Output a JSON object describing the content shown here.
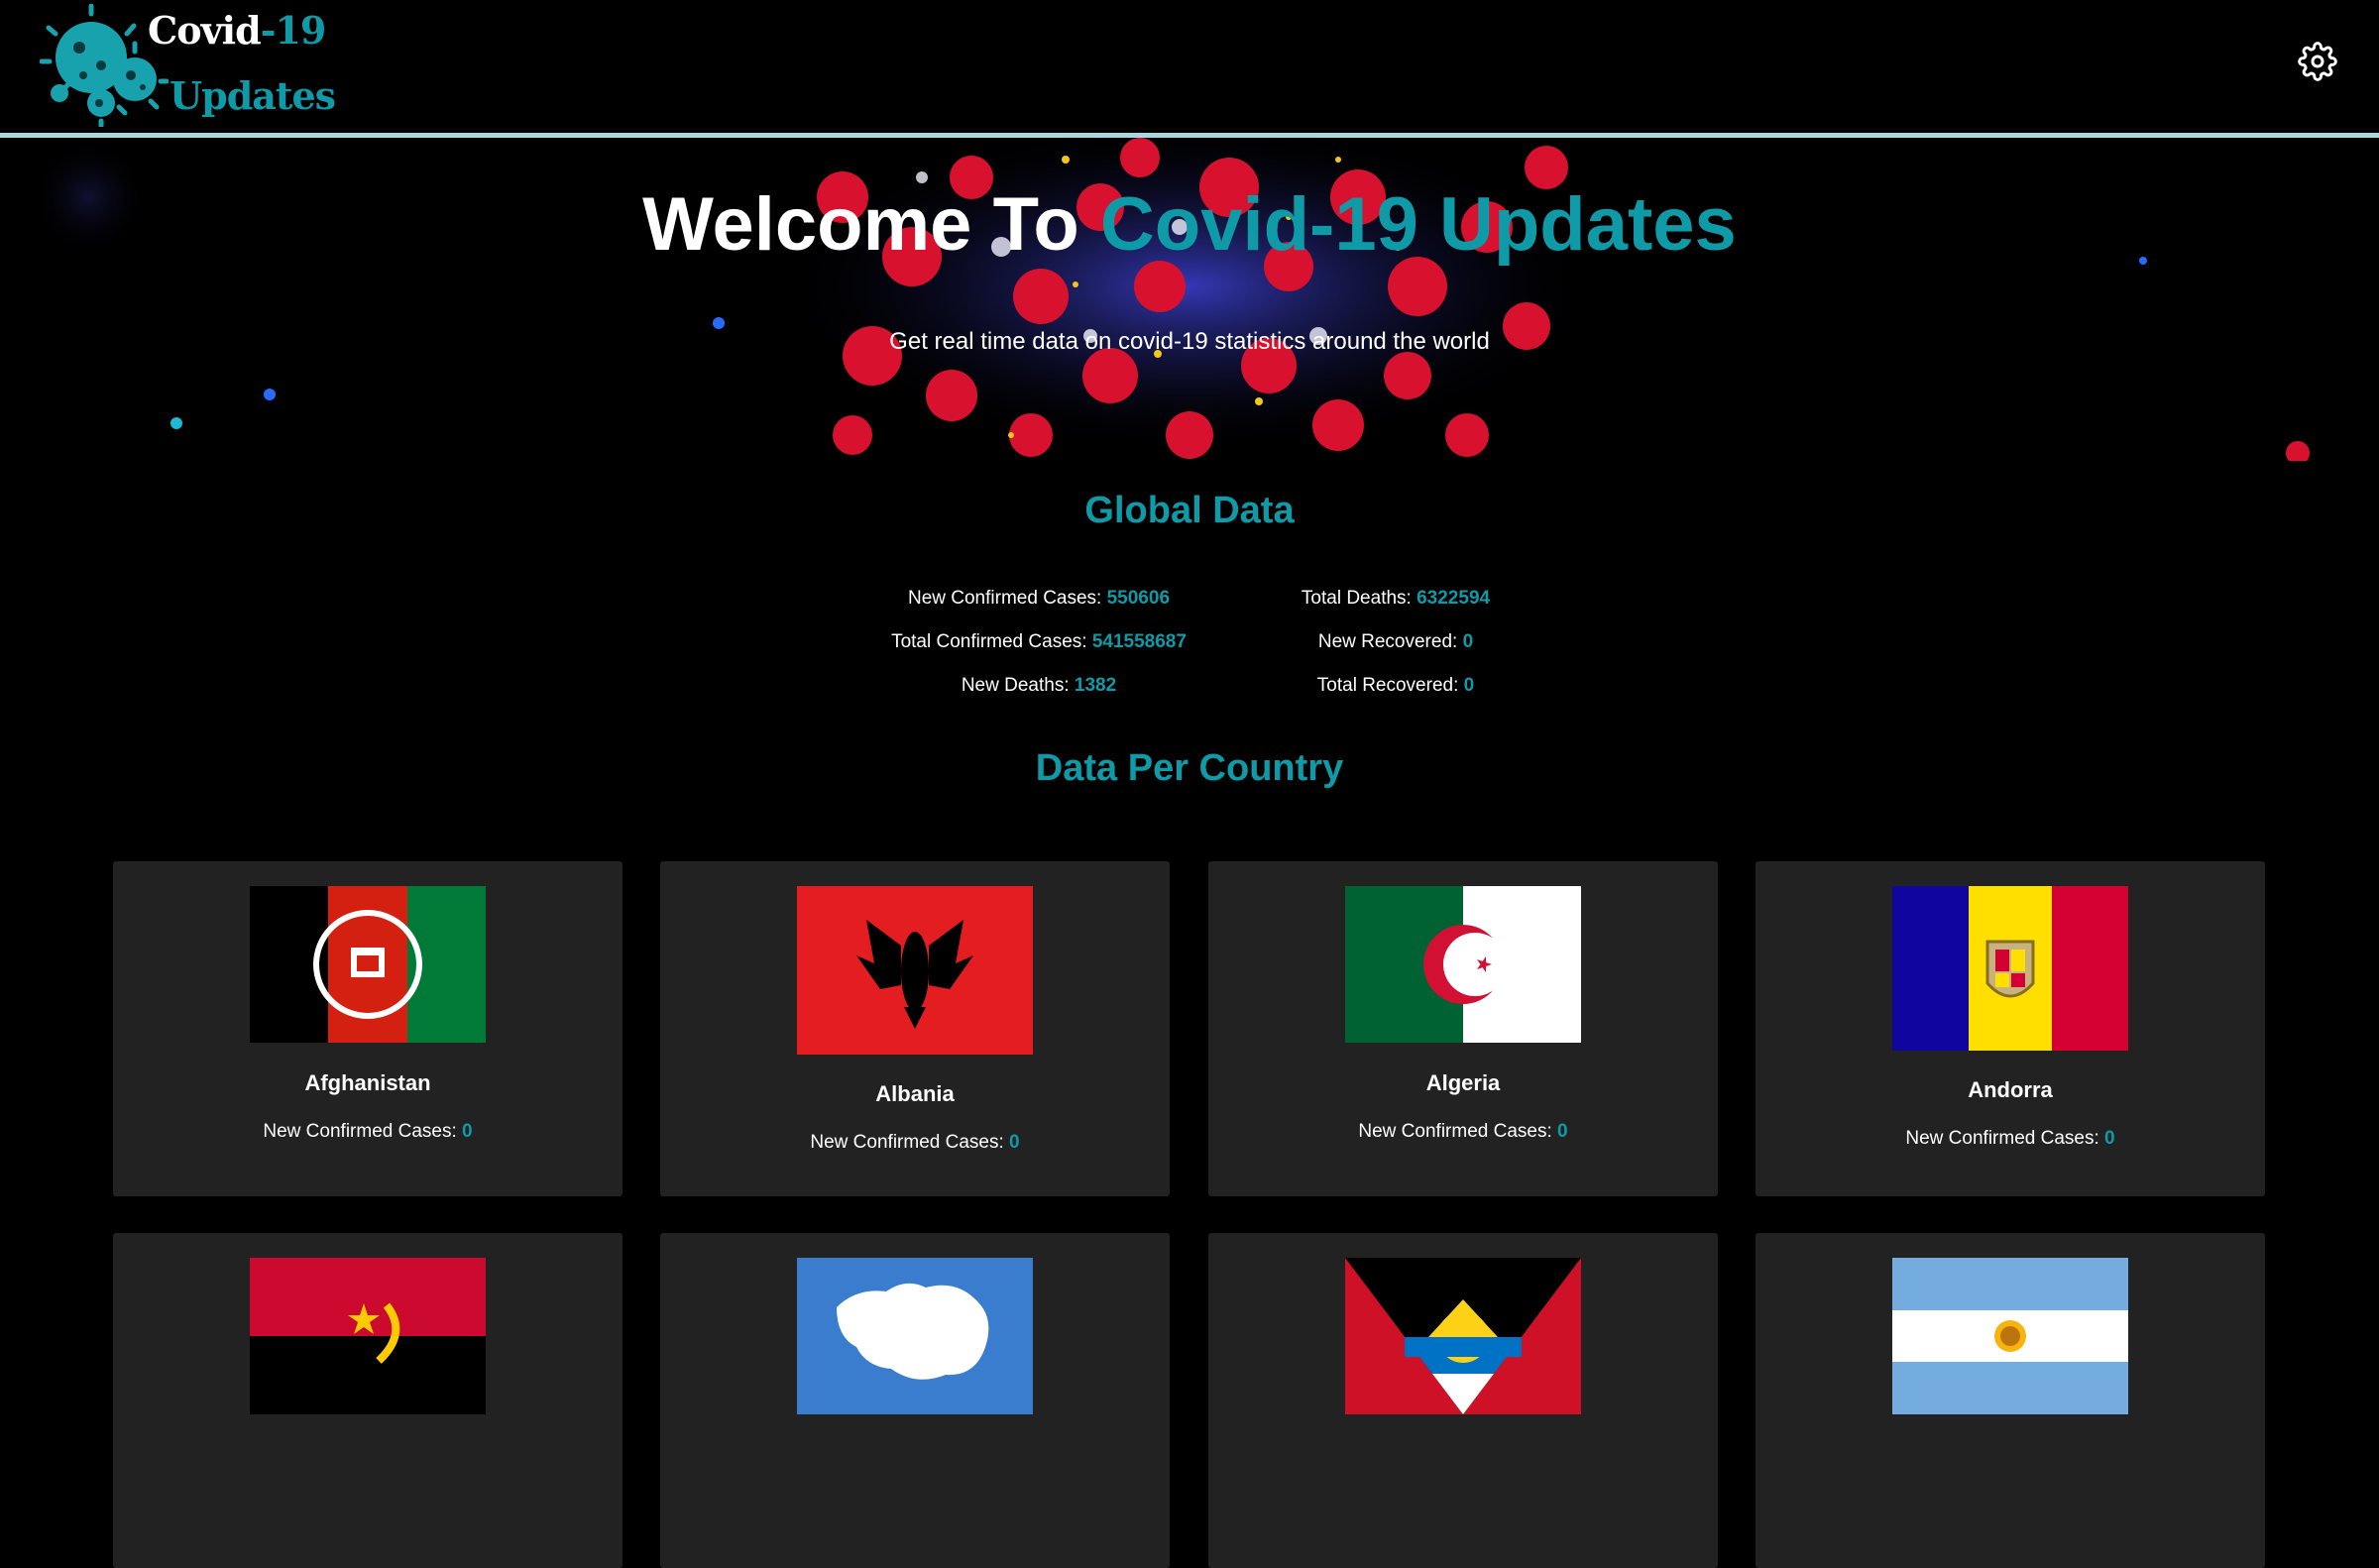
{
  "app": {
    "logo_line1_a": "Covid",
    "logo_line1_b": "-19",
    "logo_line2": "Updates",
    "accent_color": "#0e9aa7"
  },
  "hero": {
    "title_a": "Welcome To ",
    "title_b": "Covid-19 Updates",
    "subtitle": "Get real time data on covid-19 statistics around the world"
  },
  "global": {
    "title": "Global Data",
    "stats": [
      {
        "label": "New Confirmed Cases:",
        "value": "550606"
      },
      {
        "label": "Total Deaths:",
        "value": "6322594"
      },
      {
        "label": "Total Confirmed Cases:",
        "value": "541558687"
      },
      {
        "label": "New Recovered:",
        "value": "0"
      },
      {
        "label": "New Deaths:",
        "value": "1382"
      },
      {
        "label": "Total Recovered:",
        "value": "0"
      }
    ]
  },
  "countries": {
    "title": "Data Per Country",
    "cases_label": "New Confirmed Cases:",
    "items": [
      {
        "name": "Afghanistan",
        "value": "0",
        "flag": "afghanistan-flag"
      },
      {
        "name": "Albania",
        "value": "0",
        "flag": "albania-flag"
      },
      {
        "name": "Algeria",
        "value": "0",
        "flag": "algeria-flag"
      },
      {
        "name": "Andorra",
        "value": "0",
        "flag": "andorra-flag"
      },
      {
        "name": "",
        "value": "",
        "flag": "angola-flag"
      },
      {
        "name": "",
        "value": "",
        "flag": "antarctica-flag"
      },
      {
        "name": "",
        "value": "",
        "flag": "antigua-and-barbuda-flag"
      },
      {
        "name": "",
        "value": "",
        "flag": "argentina-flag"
      }
    ]
  }
}
